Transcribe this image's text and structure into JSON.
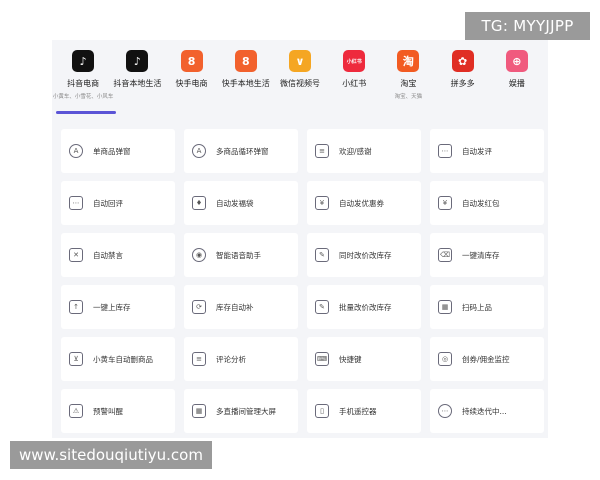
{
  "watermarks": {
    "top": "TG: MYYJJPP",
    "bottom": "www.sitedouqiutiyu.com"
  },
  "colors": {
    "accent": "#5b54d6",
    "panel_bg": "#f4f5f8"
  },
  "platforms": [
    {
      "name": "抖音电商",
      "sub": "小黄车、小雪花、小风车",
      "icon": "tiktok-icon",
      "color": "#111111",
      "glyph": "♪"
    },
    {
      "name": "抖音本地生活",
      "sub": "",
      "icon": "tiktok-icon",
      "color": "#111111",
      "glyph": "♪"
    },
    {
      "name": "快手电商",
      "sub": "",
      "icon": "kuaishou-icon",
      "color": "#f2612d",
      "glyph": "8"
    },
    {
      "name": "快手本地生活",
      "sub": "",
      "icon": "kuaishou-icon",
      "color": "#f2612d",
      "glyph": "8"
    },
    {
      "name": "微信视频号",
      "sub": "",
      "icon": "wechat-channels-icon",
      "color": "#f5a623",
      "glyph": "∨"
    },
    {
      "name": "小红书",
      "sub": "",
      "icon": "xiaohongshu-icon",
      "color": "#ee2a3d",
      "glyph": "小红书"
    },
    {
      "name": "淘宝",
      "sub": "淘宝、天猫",
      "icon": "taobao-icon",
      "color": "#f25b22",
      "glyph": "淘"
    },
    {
      "name": "拼多多",
      "sub": "",
      "icon": "pinduoduo-icon",
      "color": "#e02e24",
      "glyph": "✿"
    },
    {
      "name": "娱播",
      "sub": "",
      "icon": "yubo-icon",
      "color": "#f05a7e",
      "glyph": "⊕"
    }
  ],
  "features": [
    {
      "label": "单商品弹窗",
      "icon": "single-product-popup-icon",
      "glyph": "A"
    },
    {
      "label": "多商品循环弹窗",
      "icon": "multi-product-popup-icon",
      "glyph": "A"
    },
    {
      "label": "欢迎/感谢",
      "icon": "welcome-thanks-icon",
      "glyph": "≡"
    },
    {
      "label": "自动发评",
      "icon": "auto-comment-icon",
      "glyph": "⋯"
    },
    {
      "label": "自动回评",
      "icon": "auto-reply-comment-icon",
      "glyph": "⋯"
    },
    {
      "label": "自动发福袋",
      "icon": "lucky-bag-icon",
      "glyph": "♦"
    },
    {
      "label": "自动发优惠券",
      "icon": "coupon-icon",
      "glyph": "¥"
    },
    {
      "label": "自动发红包",
      "icon": "red-envelope-icon",
      "glyph": "¥"
    },
    {
      "label": "自动禁言",
      "icon": "mute-icon",
      "glyph": "✕"
    },
    {
      "label": "智能语音助手",
      "icon": "voice-assistant-icon",
      "glyph": "◉"
    },
    {
      "label": "同时改价改库存",
      "icon": "edit-price-stock-icon",
      "glyph": "✎"
    },
    {
      "label": "一键清库存",
      "icon": "clear-stock-icon",
      "glyph": "⌫"
    },
    {
      "label": "一键上库存",
      "icon": "add-stock-icon",
      "glyph": "↑"
    },
    {
      "label": "库存自动补",
      "icon": "auto-restock-icon",
      "glyph": "⟳"
    },
    {
      "label": "批量改价改库存",
      "icon": "batch-edit-icon",
      "glyph": "✎"
    },
    {
      "label": "扫码上品",
      "icon": "scan-code-icon",
      "glyph": "▦"
    },
    {
      "label": "小黄车自动删商品",
      "icon": "cart-icon",
      "glyph": "⊻"
    },
    {
      "label": "评论分析",
      "icon": "comment-analysis-icon",
      "glyph": "≡"
    },
    {
      "label": "快捷键",
      "icon": "keyboard-icon",
      "glyph": "⌨"
    },
    {
      "label": "创券/佣金监控",
      "icon": "commission-monitor-icon",
      "glyph": "◎"
    },
    {
      "label": "预警叫醒",
      "icon": "alarm-icon",
      "glyph": "⚠"
    },
    {
      "label": "多直播间管理大屏",
      "icon": "multi-room-icon",
      "glyph": "▦"
    },
    {
      "label": "手机遥控器",
      "icon": "phone-remote-icon",
      "glyph": "▯"
    },
    {
      "label": "持续迭代中...",
      "icon": "more-icon",
      "glyph": "⋯"
    }
  ]
}
